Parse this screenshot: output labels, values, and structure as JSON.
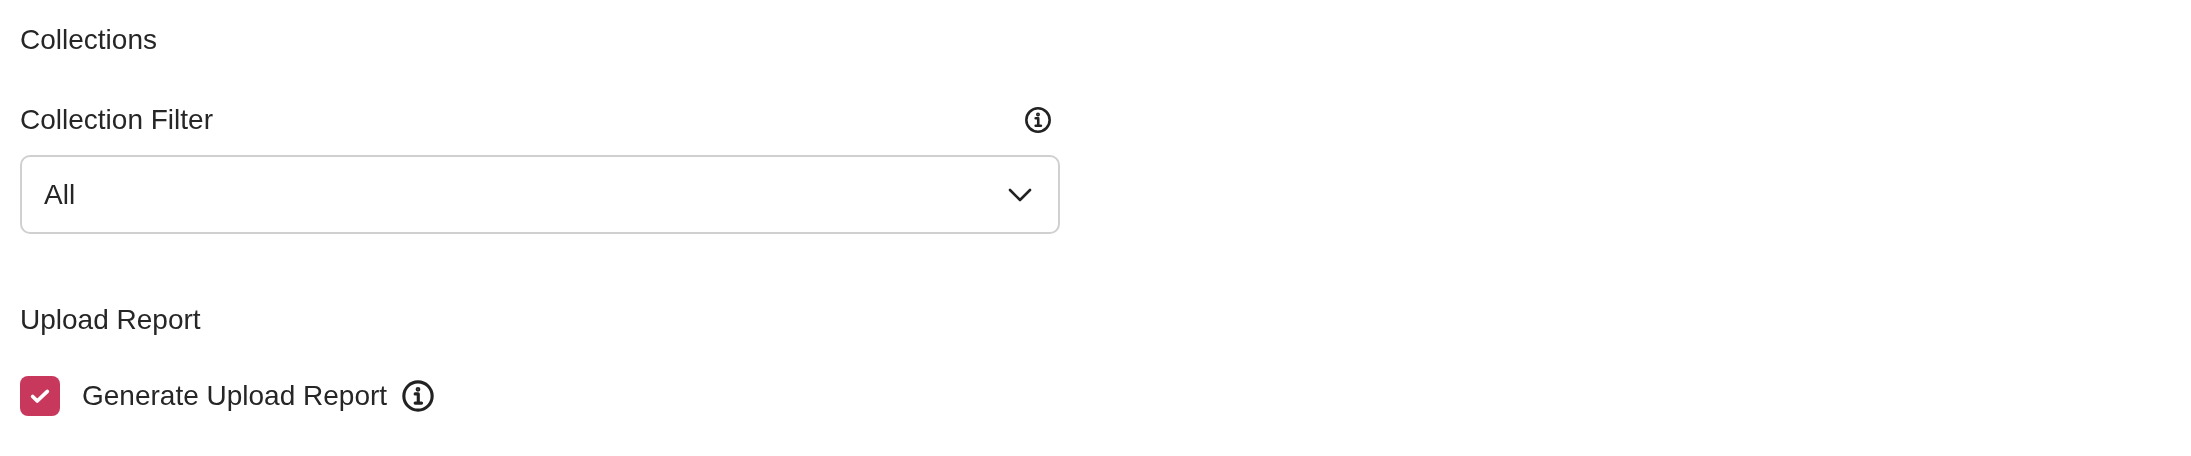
{
  "collections_section": {
    "heading": "Collections",
    "filter": {
      "label": "Collection Filter",
      "value": "All"
    }
  },
  "upload_report_section": {
    "heading": "Upload Report",
    "checkbox": {
      "label": "Generate Upload Report",
      "checked": true
    }
  }
}
